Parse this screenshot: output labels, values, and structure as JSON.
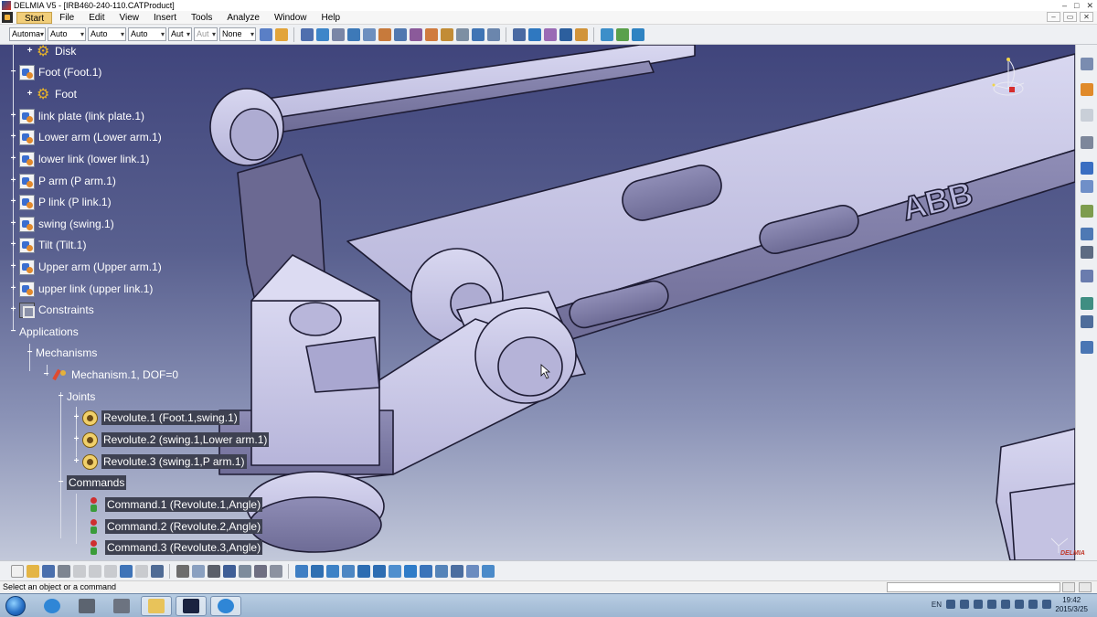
{
  "window": {
    "title": "DELMIA V5 - [IRB460-240-110.CATProduct]",
    "controls": [
      "–",
      "□",
      "✕"
    ]
  },
  "menu": {
    "items": [
      "Start",
      "File",
      "Edit",
      "View",
      "Insert",
      "Tools",
      "Analyze",
      "Window",
      "Help"
    ],
    "window_controls": [
      "–",
      "▭",
      "✕"
    ]
  },
  "toolbar": {
    "combos": [
      "Automa",
      "Auto",
      "Auto",
      "Auto",
      "Aut",
      "Aut",
      "None"
    ]
  },
  "tree": {
    "nodes": [
      {
        "label": "Disk",
        "icon": "gear-icon",
        "level": 2
      },
      {
        "label": "Foot (Foot.1)",
        "icon": "product-icon",
        "level": 1
      },
      {
        "label": "Foot",
        "icon": "gear-icon",
        "level": 2
      },
      {
        "label": "link plate (link plate.1)",
        "icon": "product-icon",
        "level": 1
      },
      {
        "label": "Lower arm (Lower arm.1)",
        "icon": "product-icon",
        "level": 1
      },
      {
        "label": "lower link (lower link.1)",
        "icon": "product-icon",
        "level": 1
      },
      {
        "label": "P arm (P arm.1)",
        "icon": "product-icon",
        "level": 1
      },
      {
        "label": "P link (P link.1)",
        "icon": "product-icon",
        "level": 1
      },
      {
        "label": "swing (swing.1)",
        "icon": "product-icon",
        "level": 1
      },
      {
        "label": "Tilt (Tilt.1)",
        "icon": "product-icon",
        "level": 1
      },
      {
        "label": "Upper arm (Upper arm.1)",
        "icon": "product-icon",
        "level": 1
      },
      {
        "label": "upper link (upper link.1)",
        "icon": "product-icon",
        "level": 1
      },
      {
        "label": "Constraints",
        "icon": "constraints-icon",
        "level": 1
      },
      {
        "label": "Applications",
        "icon": "",
        "level": 0
      },
      {
        "label": "Mechanisms",
        "icon": "",
        "level": 1
      },
      {
        "label": "Mechanism.1, DOF=0",
        "icon": "mechanism-icon",
        "level": 2
      },
      {
        "label": "Joints",
        "icon": "",
        "level": 3
      },
      {
        "label": "Revolute.1 (Foot.1,swing.1)",
        "icon": "revolute-joint-icon",
        "level": 4
      },
      {
        "label": "Revolute.2 (swing.1,Lower arm.1)",
        "icon": "revolute-joint-icon",
        "level": 4
      },
      {
        "label": "Revolute.3 (swing.1,P arm.1)",
        "icon": "revolute-joint-icon",
        "level": 4
      },
      {
        "label": "Commands",
        "icon": "",
        "level": 3
      },
      {
        "label": "Command.1 (Revolute.1,Angle)",
        "icon": "command-icon",
        "level": 4
      },
      {
        "label": "Command.2 (Revolute.2,Angle)",
        "icon": "command-icon",
        "level": 4
      },
      {
        "label": "Command.3 (Revolute.3,Angle)",
        "icon": "command-icon",
        "level": 4
      }
    ]
  },
  "model": {
    "brand_text": "ABB"
  },
  "status": {
    "message": "Select an object or a command"
  },
  "watermark": {
    "text": "DELMIA"
  },
  "taskbar": {
    "language": "EN",
    "time": "19:42",
    "date": "2015/3/25"
  },
  "colors": {
    "viewport_top": "#40457c",
    "viewport_bottom": "#c2c8da",
    "part_fill": "#c9c8e6",
    "selection": "#3e4151"
  }
}
